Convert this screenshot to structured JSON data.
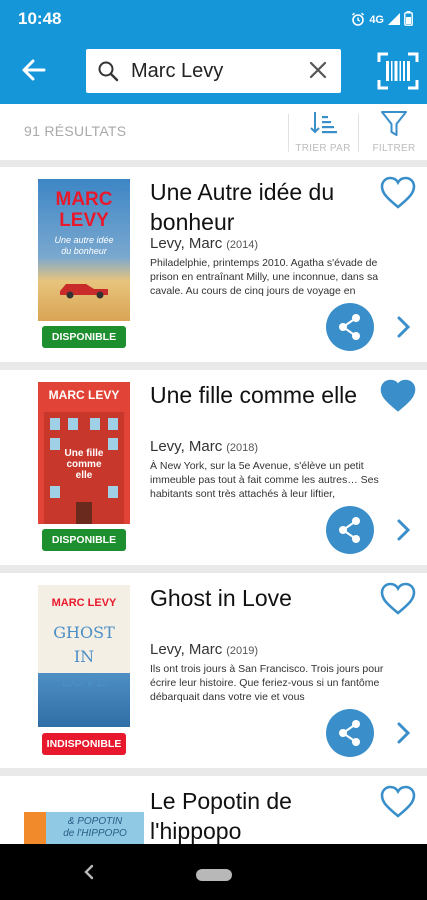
{
  "status_bar": {
    "time": "10:48",
    "network": "4G"
  },
  "search": {
    "value": "Marc Levy"
  },
  "results": {
    "count_label": "91 RÉSULTATS",
    "sort_label": "TRIER PAR",
    "filter_label": "FILTRER"
  },
  "books": [
    {
      "title": "Une Autre idée du bonheur",
      "author": "Levy, Marc",
      "year": "(2014)",
      "summary": "Philadelphie, printemps 2010. Agatha s'évade de prison en entraînant Milly, une inconnue, dans sa cavale. Au cours de cinq jours de voyage en",
      "availability": "DISPONIBLE",
      "favorite": false,
      "cover": {
        "author": "MARC\nLEVY",
        "title": "Une autre idée\ndu bonheur"
      }
    },
    {
      "title": "Une fille comme elle",
      "author": "Levy, Marc",
      "year": "(2018)",
      "summary": "À New York, sur la 5e Avenue, s'élève un petit immeuble pas tout à fait comme les autres… Ses habitants sont très attachés à leur liftier,",
      "availability": "DISPONIBLE",
      "favorite": true,
      "cover": {
        "author": "MARC LEVY",
        "title": "Une fille\ncomme\nelle"
      }
    },
    {
      "title": "Ghost in Love",
      "author": "Levy, Marc",
      "year": "(2019)",
      "summary": "Ils ont trois jours à San Francisco. Trois jours pour écrire leur histoire. Que feriez-vous si un fantôme débarquait dans votre vie et vous",
      "availability": "INDISPONIBLE",
      "favorite": false,
      "cover": {
        "author": "MARC LEVY",
        "title": "GHOST\nIN\nLOVE"
      }
    },
    {
      "title": "Le Popotin de l'hippopo",
      "author": "",
      "year": "",
      "summary": "",
      "availability": "",
      "favorite": false,
      "cover": {
        "author": "",
        "title": "& POPOTIN\nde l'HIPPOPO"
      }
    }
  ],
  "colors": {
    "primary": "#1596d8",
    "available": "#1e8f2e",
    "unavailable": "#e8192c",
    "accent": "#3a8fca"
  }
}
